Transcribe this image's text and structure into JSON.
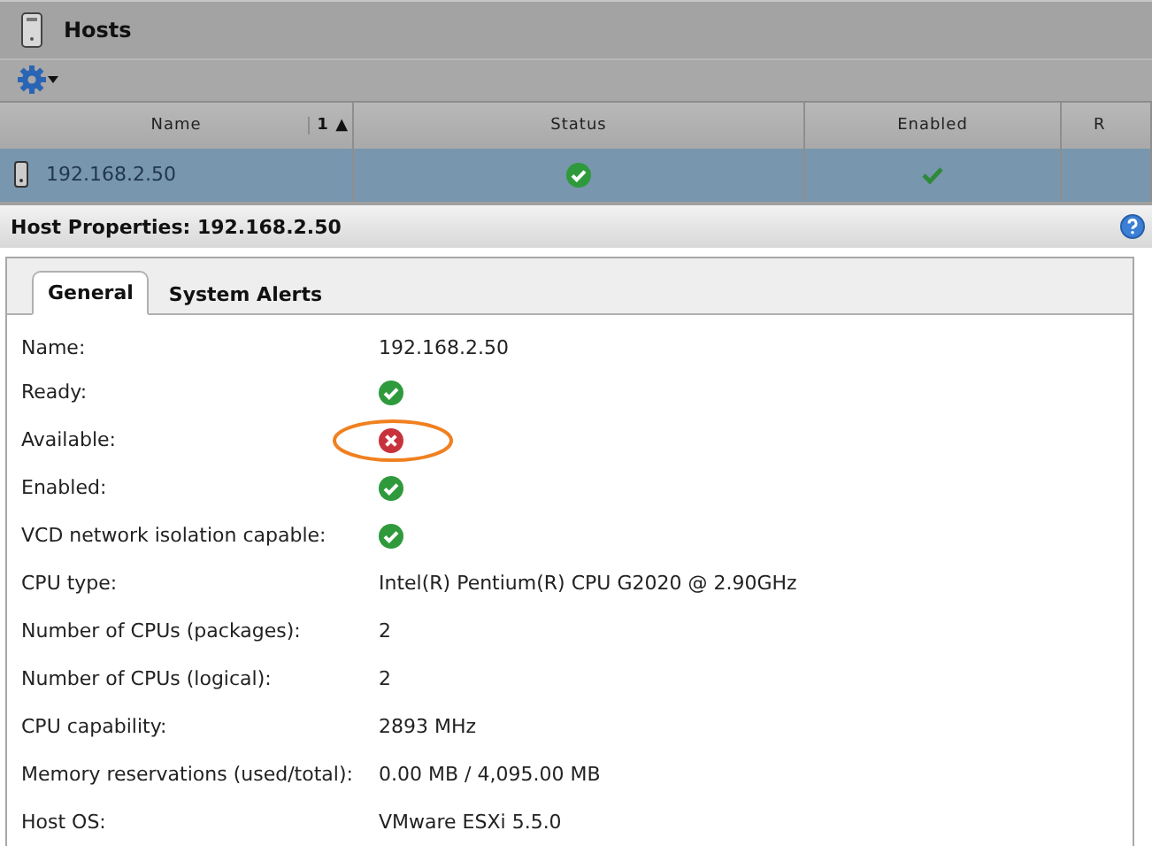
{
  "panel": {
    "title": "Hosts"
  },
  "table": {
    "columns": [
      {
        "label": "Name",
        "sort_order": "1",
        "sort_icon": "▲"
      },
      {
        "label": "Status"
      },
      {
        "label": "Enabled"
      },
      {
        "label": "R"
      }
    ],
    "rows": [
      {
        "name": "192.168.2.50",
        "status_ok": true,
        "enabled": true,
        "selected": true
      }
    ]
  },
  "properties": {
    "title": "Host Properties: 192.168.2.50",
    "tabs": [
      {
        "label": "General",
        "selected": true
      },
      {
        "label": "System Alerts",
        "selected": false
      }
    ],
    "fields": [
      {
        "label": "Name:",
        "kind": "text",
        "value": "192.168.2.50"
      },
      {
        "label": "Ready:",
        "kind": "status",
        "ok": true,
        "highlighted": false
      },
      {
        "label": "Available:",
        "kind": "status",
        "ok": false,
        "highlighted": true
      },
      {
        "label": "Enabled:",
        "kind": "status",
        "ok": true,
        "highlighted": false
      },
      {
        "label": "VCD network isolation capable:",
        "kind": "status",
        "ok": true,
        "highlighted": false
      },
      {
        "label": "CPU type:",
        "kind": "text",
        "value": "Intel(R) Pentium(R) CPU G2020 @ 2.90GHz"
      },
      {
        "label": "Number of CPUs (packages):",
        "kind": "text",
        "value": "2"
      },
      {
        "label": "Number of CPUs (logical):",
        "kind": "text",
        "value": "2"
      },
      {
        "label": "CPU capability:",
        "kind": "text",
        "value": "2893 MHz"
      },
      {
        "label": "Memory reservations (used/total):",
        "kind": "text",
        "value": "0.00 MB / 4,095.00 MB"
      },
      {
        "label": "Host OS:",
        "kind": "text",
        "value": "VMware ESXi 5.5.0"
      }
    ]
  }
}
